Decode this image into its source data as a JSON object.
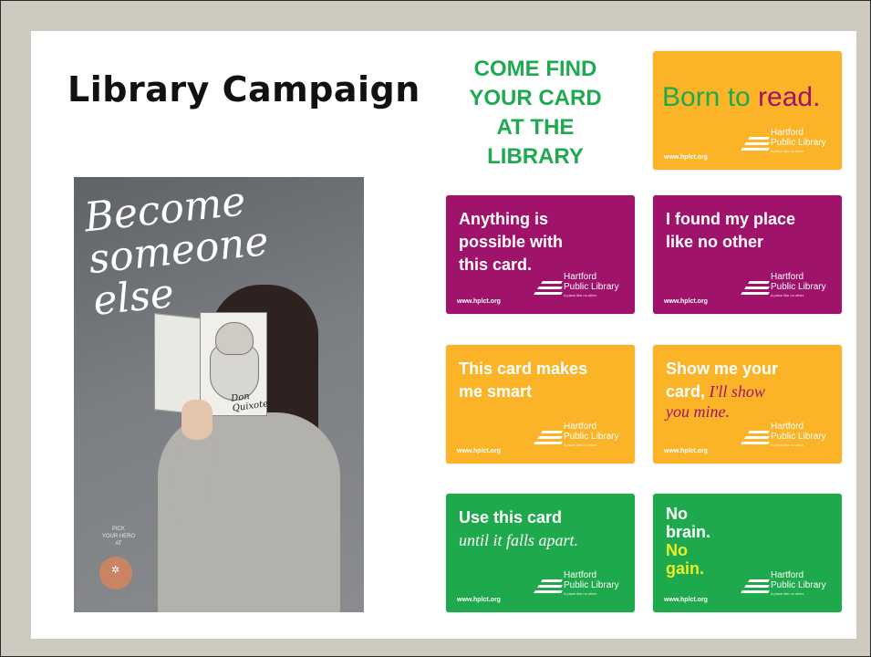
{
  "slide": {
    "title": "Library Campaign",
    "headline_lines": [
      "COME FIND",
      "YOUR CARD",
      "AT THE",
      "LIBRARY"
    ],
    "colors": {
      "green": "#1eaa4c",
      "yellow": "#fbb328",
      "magenta": "#a0136b",
      "lime": "#e9ec2a"
    }
  },
  "poster": {
    "script_lines": [
      "Become",
      "someone",
      "else"
    ],
    "book_title": "Don Quixote",
    "small_lines": [
      "PICK",
      "YOUR HERO",
      "AT"
    ]
  },
  "logo": {
    "name_line1": "Hartford",
    "name_line2": "Public Library",
    "tagline": "A place like no other.",
    "url": "www.hplct.org"
  },
  "cards": {
    "born": {
      "part1": "Born to ",
      "part2": "read."
    },
    "anything": {
      "lines": [
        "Anything is",
        "possible with",
        "this card."
      ]
    },
    "found": {
      "lines": [
        "I found my place",
        "like no other"
      ]
    },
    "smart": {
      "lines": [
        "This card makes",
        "me smart"
      ]
    },
    "show": {
      "line1": "Show me your",
      "line2a": "card,",
      "line2b": " I'll show",
      "line3": "you mine."
    },
    "use": {
      "line1": "Use this card",
      "line2": "until it falls apart."
    },
    "nobrain": {
      "lines": [
        "No",
        "brain.",
        "No",
        "gain."
      ]
    }
  }
}
